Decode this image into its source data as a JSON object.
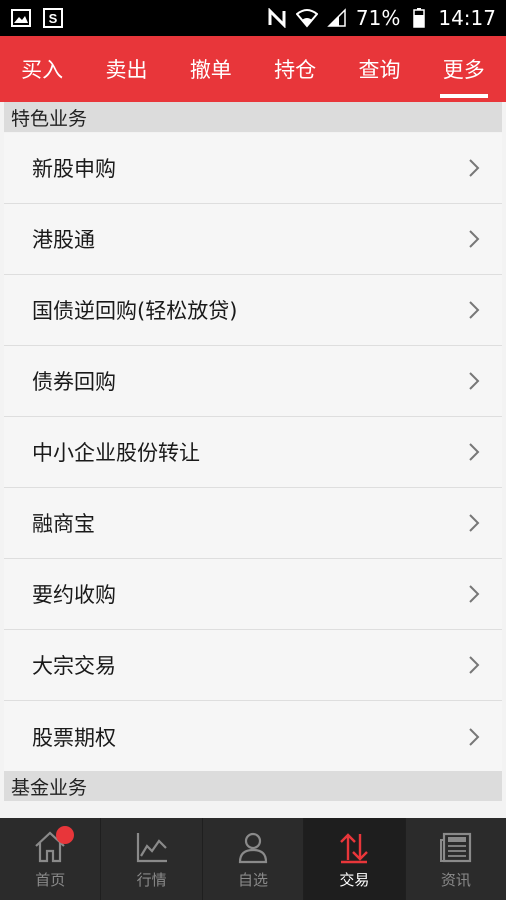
{
  "status_bar": {
    "battery": "71%",
    "time": "14:17",
    "icons": [
      "image-icon",
      "s-app-icon",
      "nfc-icon",
      "wifi-icon",
      "signal-icon",
      "battery-icon"
    ]
  },
  "tabs": [
    {
      "label": "买入",
      "active": false
    },
    {
      "label": "卖出",
      "active": false
    },
    {
      "label": "撤单",
      "active": false
    },
    {
      "label": "持仓",
      "active": false
    },
    {
      "label": "查询",
      "active": false
    },
    {
      "label": "更多",
      "active": true
    }
  ],
  "sections": [
    {
      "title": "特色业务",
      "items": [
        {
          "label": "新股申购"
        },
        {
          "label": "港股通"
        },
        {
          "label": "国债逆回购(轻松放贷)"
        },
        {
          "label": "债券回购"
        },
        {
          "label": "中小企业股份转让"
        },
        {
          "label": "融商宝"
        },
        {
          "label": "要约收购"
        },
        {
          "label": "大宗交易"
        },
        {
          "label": "股票期权"
        }
      ]
    },
    {
      "title": "基金业务",
      "items": []
    }
  ],
  "bottom_nav": [
    {
      "label": "首页",
      "icon": "home-icon",
      "badge": true
    },
    {
      "label": "行情",
      "icon": "chart-icon",
      "badge": false
    },
    {
      "label": "自选",
      "icon": "person-icon",
      "badge": false
    },
    {
      "label": "交易",
      "icon": "trade-icon",
      "badge": false,
      "active": true
    },
    {
      "label": "资讯",
      "icon": "news-icon",
      "badge": false
    }
  ],
  "colors": {
    "brand_red": "#e8363a",
    "nav_bg": "#2b2b2b"
  }
}
